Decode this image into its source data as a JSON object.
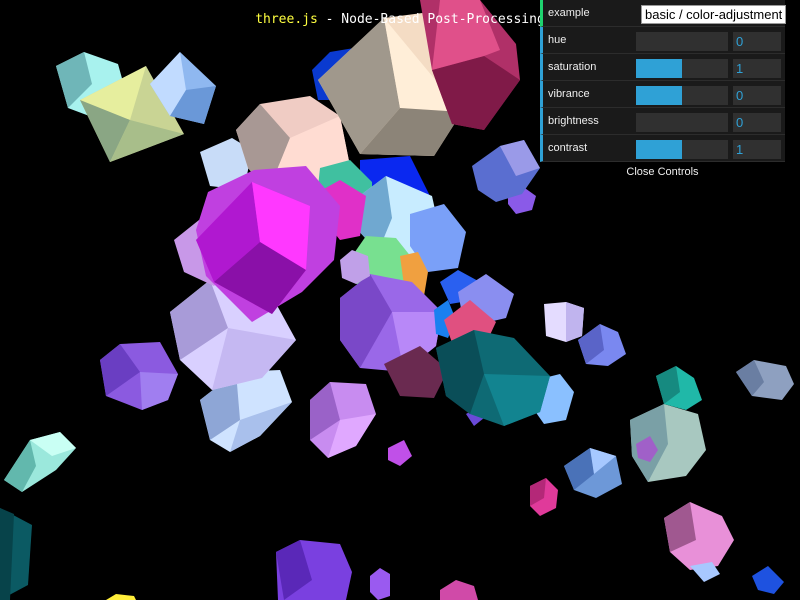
{
  "info": {
    "link_text": "three.js",
    "title_text": " - Node-Based Post-Processing"
  },
  "gui": {
    "example": {
      "label": "example",
      "value": "basic / color-adjustment"
    },
    "controls": [
      {
        "label": "hue",
        "value": "0",
        "fill": 0
      },
      {
        "label": "saturation",
        "value": "1",
        "fill": 0.5
      },
      {
        "label": "vibrance",
        "value": "0",
        "fill": 0.5
      },
      {
        "label": "brightness",
        "value": "0",
        "fill": 0
      },
      {
        "label": "contrast",
        "value": "1",
        "fill": 0.5
      }
    ],
    "close_label": "Close Controls",
    "colors": {
      "accent": "#2fa1d6",
      "string_accent": "#1ed36f",
      "panel": "#1a1a1a"
    }
  }
}
